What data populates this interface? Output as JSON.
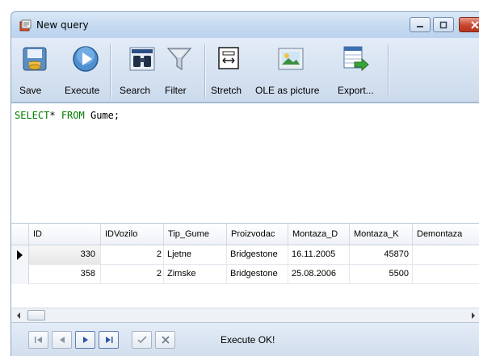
{
  "window": {
    "title": "New query",
    "controls": [
      "minimize",
      "maximize",
      "close"
    ]
  },
  "toolbar": {
    "buttons": [
      {
        "label": "Save",
        "icon": "save-database-icon"
      },
      {
        "label": "Execute",
        "icon": "execute-play-icon"
      },
      {
        "label": "Search",
        "icon": "binoculars-search-icon"
      },
      {
        "label": "Filter",
        "icon": "funnel-filter-icon"
      },
      {
        "label": "Stretch",
        "icon": "stretch-icon"
      },
      {
        "label": "OLE as picture",
        "icon": "picture-icon"
      },
      {
        "label": "Export...",
        "icon": "export-grid-icon"
      }
    ]
  },
  "editor": {
    "keyword1": "SELECT",
    "star": "*",
    "keyword2": "FROM",
    "table": "Gume;"
  },
  "grid": {
    "columns": [
      "ID",
      "IDVozilo",
      "Tip_Gume",
      "Proizvodac",
      "Montaza_D",
      "Montaza_K",
      "Demontaza"
    ],
    "rows": [
      {
        "ID": "330",
        "IDVozilo": "2",
        "Tip_Gume": "Ljetne",
        "Proizvodac": "Bridgestone",
        "Montaza_D": "16.11.2005",
        "Montaza_K": "45870",
        "Demontaza": ""
      },
      {
        "ID": "358",
        "IDVozilo": "2",
        "Tip_Gume": "Zimske",
        "Proizvodac": "Bridgestone",
        "Montaza_D": "25.08.2006",
        "Montaza_K": "5500",
        "Demontaza": ""
      }
    ],
    "current_row": 0
  },
  "navigator": {
    "buttons": [
      "first-record",
      "prior-record",
      "next-record",
      "last-record",
      "post-edit",
      "cancel-edit"
    ],
    "status": "Execute OK!"
  },
  "colors": {
    "sql_keyword": "#007c00",
    "close_button": "#c7452c",
    "toolbar_bg": "#d5e2f1"
  }
}
